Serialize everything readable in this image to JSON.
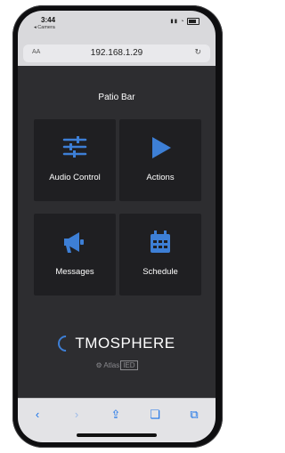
{
  "status_bar": {
    "time": "3:44",
    "back_app": "◂ Camera"
  },
  "browser": {
    "text_size_label": "AA",
    "url": "192.168.1.29"
  },
  "page": {
    "title": "Patio Bar"
  },
  "tiles": [
    {
      "label": "Audio Control",
      "icon": "sliders-icon"
    },
    {
      "label": "Actions",
      "icon": "play-icon"
    },
    {
      "label": "Messages",
      "icon": "megaphone-icon"
    },
    {
      "label": "Schedule",
      "icon": "calendar-icon"
    }
  ],
  "brand": {
    "name": "TMOSPHERE",
    "sub_left": "Atlas",
    "sub_right": "IED"
  },
  "colors": {
    "accent": "#3d7fd6",
    "tile_bg": "#1f1f22",
    "page_bg": "#2d2d30",
    "ios_blue": "#1a73e8"
  }
}
